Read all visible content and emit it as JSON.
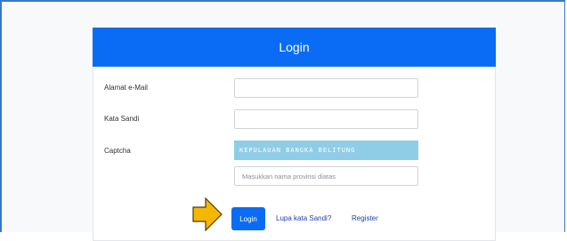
{
  "form": {
    "title": "Login",
    "email_label": "Alamat e-Mail",
    "email_value": "",
    "password_label": "Kata Sandi",
    "password_value": "",
    "captcha_label": "Captcha",
    "captcha_text": "KEPULAUAN BANGKA BELITUNG",
    "captcha_placeholder": "Masukkan nama provinsi diatas",
    "login_button": "Login",
    "forgot_link": "Lupa kata Sandi?",
    "register_link": "Register"
  },
  "annotation": {
    "icon": "arrow-right-icon",
    "color": "#f5b800"
  },
  "colors": {
    "primary": "#0a6cf5",
    "captcha_bg": "#8fcde6",
    "link": "#1f3fa8"
  }
}
